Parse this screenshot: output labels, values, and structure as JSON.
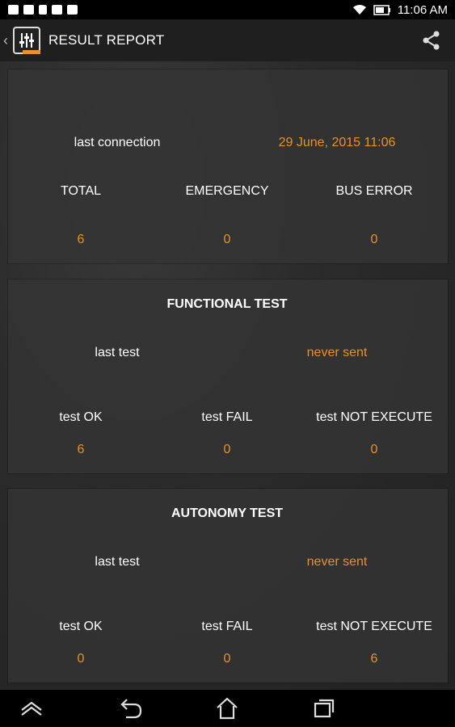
{
  "status_bar": {
    "time": "11:06 AM",
    "icons": [
      "gallery-icon",
      "camera-icon",
      "sdcard-icon",
      "store-icon",
      "bag-icon",
      "wifi-icon",
      "battery-icon"
    ]
  },
  "action_bar": {
    "title": "RESULT REPORT",
    "icons": [
      "back-chevron-icon",
      "equalizer-app-icon",
      "share-icon"
    ]
  },
  "summary": {
    "last_connection_label": "last connection",
    "last_connection_value": "29 June, 2015 11:06",
    "columns": [
      {
        "label": "TOTAL",
        "value": "6"
      },
      {
        "label": "EMERGENCY",
        "value": "0"
      },
      {
        "label": "BUS ERROR",
        "value": "0"
      }
    ]
  },
  "functional": {
    "title": "FUNCTIONAL TEST",
    "last_test_label": "last test",
    "last_test_value": "never sent",
    "columns": [
      {
        "label": "test OK",
        "value": "6"
      },
      {
        "label": "test FAIL",
        "value": "0"
      },
      {
        "label": "test NOT EXECUTE",
        "value": "0"
      }
    ]
  },
  "autonomy": {
    "title": "AUTONOMY TEST",
    "last_test_label": "last test",
    "last_test_value": "never sent",
    "columns": [
      {
        "label": "test OK",
        "value": "0"
      },
      {
        "label": "test FAIL",
        "value": "0"
      },
      {
        "label": "test NOT EXECUTE",
        "value": "6"
      }
    ]
  },
  "nav_bar": {
    "icons": [
      "apps-up-icon",
      "back-icon",
      "home-icon",
      "recents-icon"
    ]
  },
  "colors": {
    "accent": "#e8902e",
    "text": "#ffffff",
    "card": "#343434"
  }
}
